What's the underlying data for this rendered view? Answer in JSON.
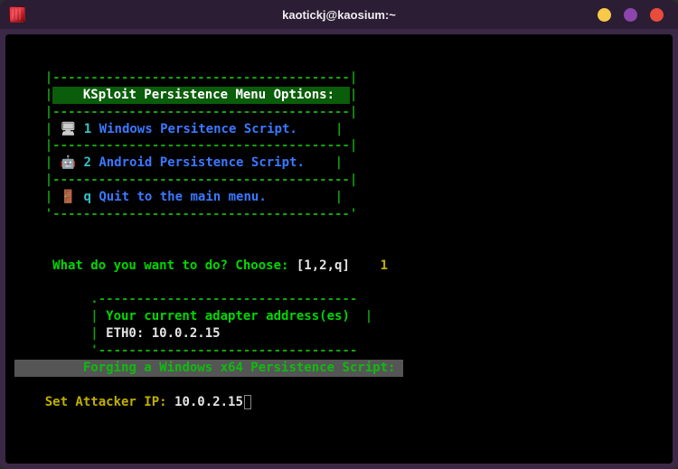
{
  "window": {
    "title": "kaotickj@kaosium:~"
  },
  "menu": {
    "border_top": "    |---------------------------------------|",
    "title_pre": "    |",
    "title": "    KSploit Persistence Menu Options:  ",
    "title_post": "|",
    "divider": "    |---------------------------------------|",
    "items": [
      {
        "pipe": "    | ",
        "icon": "🖥",
        "key": " 1 ",
        "label": "Windows Persitence Script.",
        "pad": "     |"
      },
      {
        "pipe": "    | ",
        "icon": "🤖",
        "key": " 2 ",
        "label": "Android Persistence Script.",
        "pad": "    |"
      },
      {
        "pipe": "    | ",
        "icon": "🚪",
        "key": " q ",
        "label": "Quit to the main menu.",
        "pad": "         |"
      }
    ],
    "border_bot": "    '---------------------------------------'"
  },
  "prompt": {
    "question": "     What do you want to do? Choose: ",
    "options": "[1,2,q]",
    "spacer": "    ",
    "answer": "1"
  },
  "adapter": {
    "top": "          .----------------------------------",
    "head_pre": "          |",
    "head": " Your current adapter address(es) ",
    "head_post": " |",
    "line_pre": "          |",
    "iface": " ETH0: ",
    "ip": "10.0.2.15",
    "bot": "          '----------------------------------"
  },
  "forge": {
    "spacer": "        ",
    "text": " Forging a Windows x64 Persistence Script: "
  },
  "input": {
    "spacer": "    ",
    "label": "Set Attacker IP: ",
    "value": "10.0.2.15"
  }
}
